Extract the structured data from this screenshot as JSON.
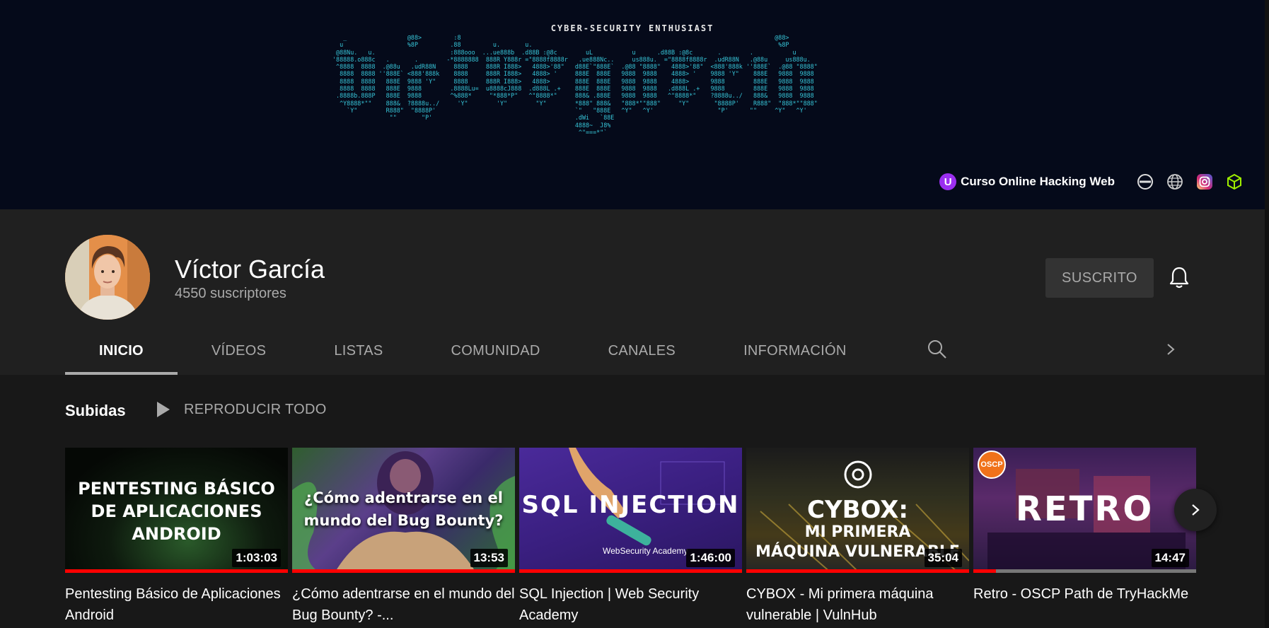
{
  "banner": {
    "tagline": "CYBER-SECURITY ENTHUSIAST",
    "ascii_art": "   _                 @88>         :8                                                                                        @88>\n  u                  %8P         .88         u.       u.                                                                     %8P\n @88Nu.   u.                     :888ooo  ...ue888b  .d88B :@8c        uL           u      .d88B :@8c       .        .           u\n'88888.o888c   .       .        -*8888888  888R Y888r =\"8888f8888r   .ue888Nc..     us888u.  =\"8888f8888r  .udR88N   .@88u     us888u.\n ^8888  8888  .@88u   .udR88N     8888     888R I888>   4888>'88\"   d88E`\"888E`  .@88 \"8888\"   4888>'88\"  <888'888k ''888E`  .@88 \"8888\"\n  8888  8888 ''888E` <888'888k    8888     888R I888>   4888> '     888E  888E   9888  9888    4888> '    9888 'Y\"    888E   9888  9888\n  8888  8888   888E  9888 'Y\"     8888     888R I888>   4888>       888E  888E   9888  9888    4888>      9888        888E   9888  9888\n  8888  8888   888E  9888        .8888Lu=  u8888cJ888  .d888L .+    888E  888E   9888  9888   .d888L .+   9888        888E   9888  9888\n .8888b.888P   888E  9888        ^%888*     \"*888*P\"   ^\"8888*\"     888& .888E   9888  9888   ^\"8888*\"    ?8888u../   888&   9888  9888\n  ^Y8888*\"\"    888&  ?8888u../     'Y\"        'Y\"        \"Y\"        *888\" 888&   \"888*\"\"888\"     \"Y\"       \"8888P'    R888\"  \"888*\"\"888\"\n    `Y\"        R888\"  \"8888P'                                       `\"   \"888E   ^Y\"   ^Y'                  \"P'      \"\"     ^Y\"   ^Y'\n                \"\"       \"P'                                        .dWi   `88E\n                                                                    4888~  J8%\n                                                                     ^\"===*\"`",
    "link_label": "Curso Online Hacking Web",
    "link_icon_letter": "U",
    "social_icons": [
      "no-entry-icon",
      "globe-icon",
      "instagram-icon",
      "cube-icon"
    ]
  },
  "channel": {
    "name": "Víctor García",
    "subscribers": "4550 suscriptores",
    "subscribe_label": "SUSCRITO"
  },
  "tabs": [
    {
      "label": "INICIO",
      "active": true
    },
    {
      "label": "VÍDEOS",
      "active": false
    },
    {
      "label": "LISTAS",
      "active": false
    },
    {
      "label": "COMUNIDAD",
      "active": false
    },
    {
      "label": "CANALES",
      "active": false
    },
    {
      "label": "INFORMACIÓN",
      "active": false
    }
  ],
  "shelf": {
    "title": "Subidas",
    "play_all_label": "REPRODUCIR TODO"
  },
  "videos": [
    {
      "thumb_lines": [
        "PENTESTING BÁSICO",
        "DE APLICACIONES",
        "ANDROID"
      ],
      "duration": "1:03:03",
      "watched": 1.0,
      "title": "Pentesting Básico de Aplicaciones Android"
    },
    {
      "thumb_lines": [
        "¿Cómo adentrarse en el",
        "mundo del Bug Bounty?"
      ],
      "duration": "13:53",
      "watched": 1.0,
      "title": "¿Cómo adentrarse en el mundo del Bug Bounty? -..."
    },
    {
      "thumb_lines": [
        "SQL INJECTION"
      ],
      "thumb_sub": "WebSecurity Academy",
      "duration": "1:46:00",
      "watched": 1.0,
      "title": "SQL Injection | Web Security Academy"
    },
    {
      "thumb_lines": [
        "CYBOX:",
        "MI PRIMERA",
        "MÁQUINA VULNERABLE"
      ],
      "duration": "35:04",
      "watched": 1.0,
      "title": "CYBOX - Mi primera máquina vulnerable | VulnHub"
    },
    {
      "thumb_lines": [
        "RETRO"
      ],
      "thumb_badge": "OSCP",
      "duration": "14:47",
      "watched": 0.1,
      "title": "Retro - OSCP Path de TryHackMe"
    }
  ],
  "colors": {
    "banner_bg": "#050a1a",
    "ascii": "#37c5d8",
    "progress": "#ff0000",
    "page_bg": "#181818",
    "header_bg": "#202020"
  }
}
